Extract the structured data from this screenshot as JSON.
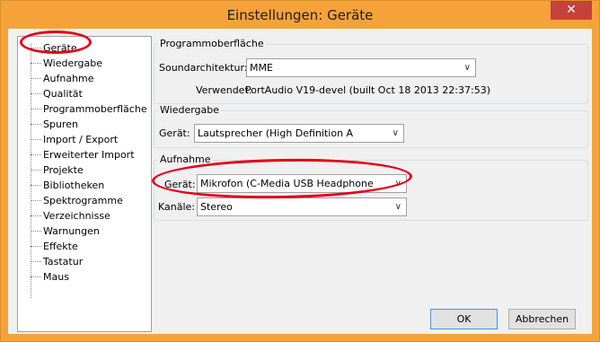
{
  "window": {
    "title": "Einstellungen: Geräte",
    "close_symbol": "✕"
  },
  "tree": {
    "items": [
      "Geräte",
      "Wiedergabe",
      "Aufnahme",
      "Qualität",
      "Programmoberfläche",
      "Spuren",
      "Import / Export",
      "Erweiterter Import",
      "Projekte",
      "Bibliotheken",
      "Spektrogramme",
      "Verzeichnisse",
      "Warnungen",
      "Effekte",
      "Tastatur",
      "Maus"
    ]
  },
  "programmoberflaeche": {
    "title": "Programmoberfläche",
    "soundarchitektur_label": "Soundarchitektur:",
    "soundarchitektur_value": "MME",
    "verwendet_label": "Verwendet:",
    "verwendet_value": "PortAudio V19-devel (built Oct 18 2013 22:37:53)"
  },
  "wiedergabe": {
    "title": "Wiedergabe",
    "geraet_label": "Gerät:",
    "geraet_value": "Lautsprecher (High Definition A"
  },
  "aufnahme": {
    "title": "Aufnahme",
    "geraet_label": "Gerät:",
    "geraet_value": "Mikrofon (C-Media USB Headphone",
    "kanaele_label": "Kanäle:",
    "kanaele_value": "Stereo"
  },
  "buttons": {
    "ok": "OK",
    "cancel": "Abbrechen"
  },
  "icons": {
    "dropdown_arrow": "∨"
  },
  "colors": {
    "titlebar": "#f5a23a",
    "close": "#c7413a",
    "annotation": "#e3001b"
  }
}
